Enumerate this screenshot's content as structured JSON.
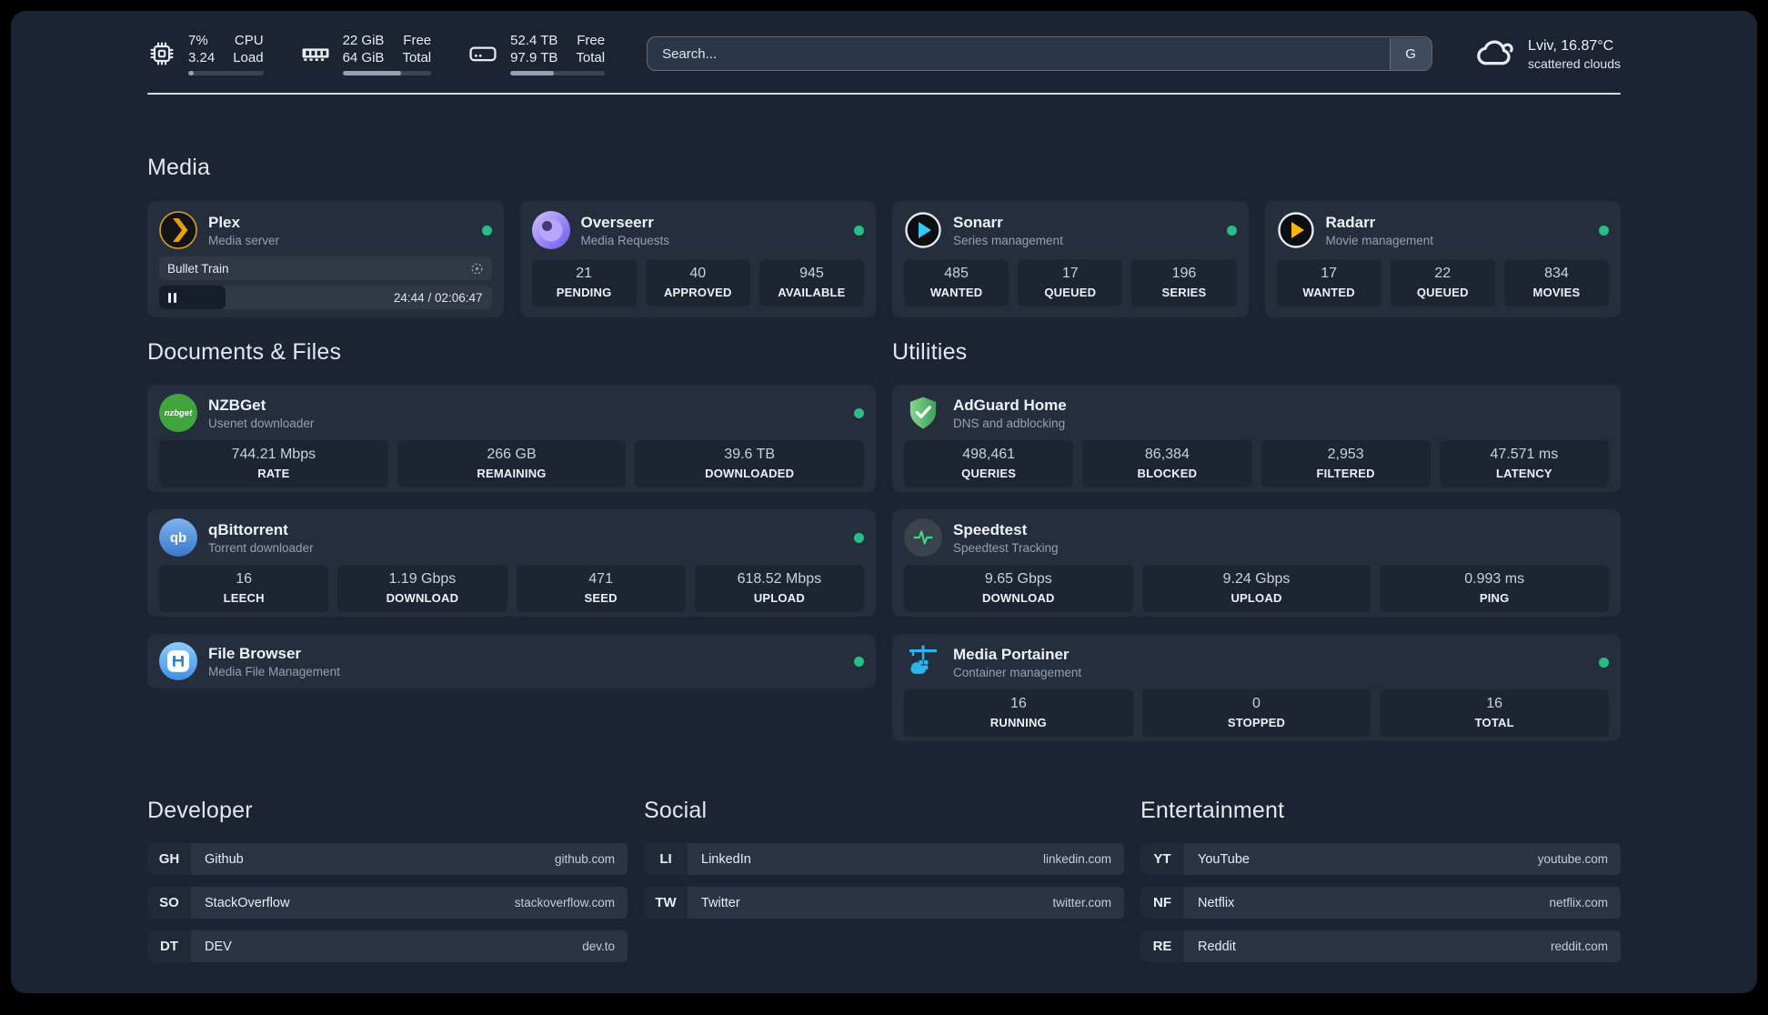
{
  "system": {
    "cpu": {
      "values": [
        "7%",
        "3.24"
      ],
      "labels": [
        "CPU",
        "Load"
      ],
      "percent": 7
    },
    "memory": {
      "values": [
        "22 GiB",
        "64 GiB"
      ],
      "labels": [
        "Free",
        "Total"
      ],
      "percent": 66
    },
    "storage": {
      "values": [
        "52.4 TB",
        "97.9 TB"
      ],
      "labels": [
        "Free",
        "Total"
      ],
      "percent": 46
    }
  },
  "search": {
    "placeholder": "Search...",
    "provider_label": "G"
  },
  "weather": {
    "location": "Lviv, 16.87°C",
    "condition": "scattered clouds"
  },
  "colors": {
    "background": "#1c2433",
    "card": "#252e3d",
    "tile": "#1d2533",
    "status_online": "#27bd84",
    "plex_accent": "#e5a00d"
  },
  "sections": {
    "media": "Media",
    "documents": "Documents & Files",
    "utilities": "Utilities",
    "developer": "Developer",
    "social": "Social",
    "entertainment": "Entertainment"
  },
  "apps": {
    "plex": {
      "name": "Plex",
      "description": "Media server",
      "player": {
        "title": "Bullet Train",
        "time": "24:44 / 02:06:47",
        "progress_percent": 20
      }
    },
    "overseerr": {
      "name": "Overseerr",
      "description": "Media Requests",
      "stats": [
        {
          "value": "21",
          "label": "PENDING"
        },
        {
          "value": "40",
          "label": "APPROVED"
        },
        {
          "value": "945",
          "label": "AVAILABLE"
        }
      ]
    },
    "sonarr": {
      "name": "Sonarr",
      "description": "Series management",
      "stats": [
        {
          "value": "485",
          "label": "WANTED"
        },
        {
          "value": "17",
          "label": "QUEUED"
        },
        {
          "value": "196",
          "label": "SERIES"
        }
      ]
    },
    "radarr": {
      "name": "Radarr",
      "description": "Movie management",
      "stats": [
        {
          "value": "17",
          "label": "WANTED"
        },
        {
          "value": "22",
          "label": "QUEUED"
        },
        {
          "value": "834",
          "label": "MOVIES"
        }
      ]
    },
    "nzbget": {
      "name": "NZBGet",
      "description": "Usenet downloader",
      "icon_text": "nzbget",
      "stats": [
        {
          "value": "744.21 Mbps",
          "label": "RATE"
        },
        {
          "value": "266 GB",
          "label": "REMAINING"
        },
        {
          "value": "39.6 TB",
          "label": "DOWNLOADED"
        }
      ]
    },
    "qbittorrent": {
      "name": "qBittorrent",
      "description": "Torrent downloader",
      "icon_text": "qb",
      "stats": [
        {
          "value": "16",
          "label": "LEECH"
        },
        {
          "value": "1.19 Gbps",
          "label": "DOWNLOAD"
        },
        {
          "value": "471",
          "label": "SEED"
        },
        {
          "value": "618.52 Mbps",
          "label": "UPLOAD"
        }
      ]
    },
    "filebrowser": {
      "name": "File Browser",
      "description": "Media File Management"
    },
    "adguard": {
      "name": "AdGuard Home",
      "description": "DNS and adblocking",
      "stats": [
        {
          "value": "498,461",
          "label": "QUERIES"
        },
        {
          "value": "86,384",
          "label": "BLOCKED"
        },
        {
          "value": "2,953",
          "label": "FILTERED"
        },
        {
          "value": "47.571 ms",
          "label": "LATENCY"
        }
      ]
    },
    "speedtest": {
      "name": "Speedtest",
      "description": "Speedtest Tracking",
      "stats": [
        {
          "value": "9.65 Gbps",
          "label": "DOWNLOAD"
        },
        {
          "value": "9.24 Gbps",
          "label": "UPLOAD"
        },
        {
          "value": "0.993 ms",
          "label": "PING"
        }
      ]
    },
    "portainer": {
      "name": "Media Portainer",
      "description": "Container management",
      "stats": [
        {
          "value": "16",
          "label": "RUNNING"
        },
        {
          "value": "0",
          "label": "STOPPED"
        },
        {
          "value": "16",
          "label": "TOTAL"
        }
      ]
    }
  },
  "links": {
    "developer": [
      {
        "abbr": "GH",
        "name": "Github",
        "url": "github.com"
      },
      {
        "abbr": "SO",
        "name": "StackOverflow",
        "url": "stackoverflow.com"
      },
      {
        "abbr": "DT",
        "name": "DEV",
        "url": "dev.to"
      }
    ],
    "social": [
      {
        "abbr": "LI",
        "name": "LinkedIn",
        "url": "linkedin.com"
      },
      {
        "abbr": "TW",
        "name": "Twitter",
        "url": "twitter.com"
      }
    ],
    "entertainment": [
      {
        "abbr": "YT",
        "name": "YouTube",
        "url": "youtube.com"
      },
      {
        "abbr": "NF",
        "name": "Netflix",
        "url": "netflix.com"
      },
      {
        "abbr": "RE",
        "name": "Reddit",
        "url": "reddit.com"
      }
    ]
  }
}
